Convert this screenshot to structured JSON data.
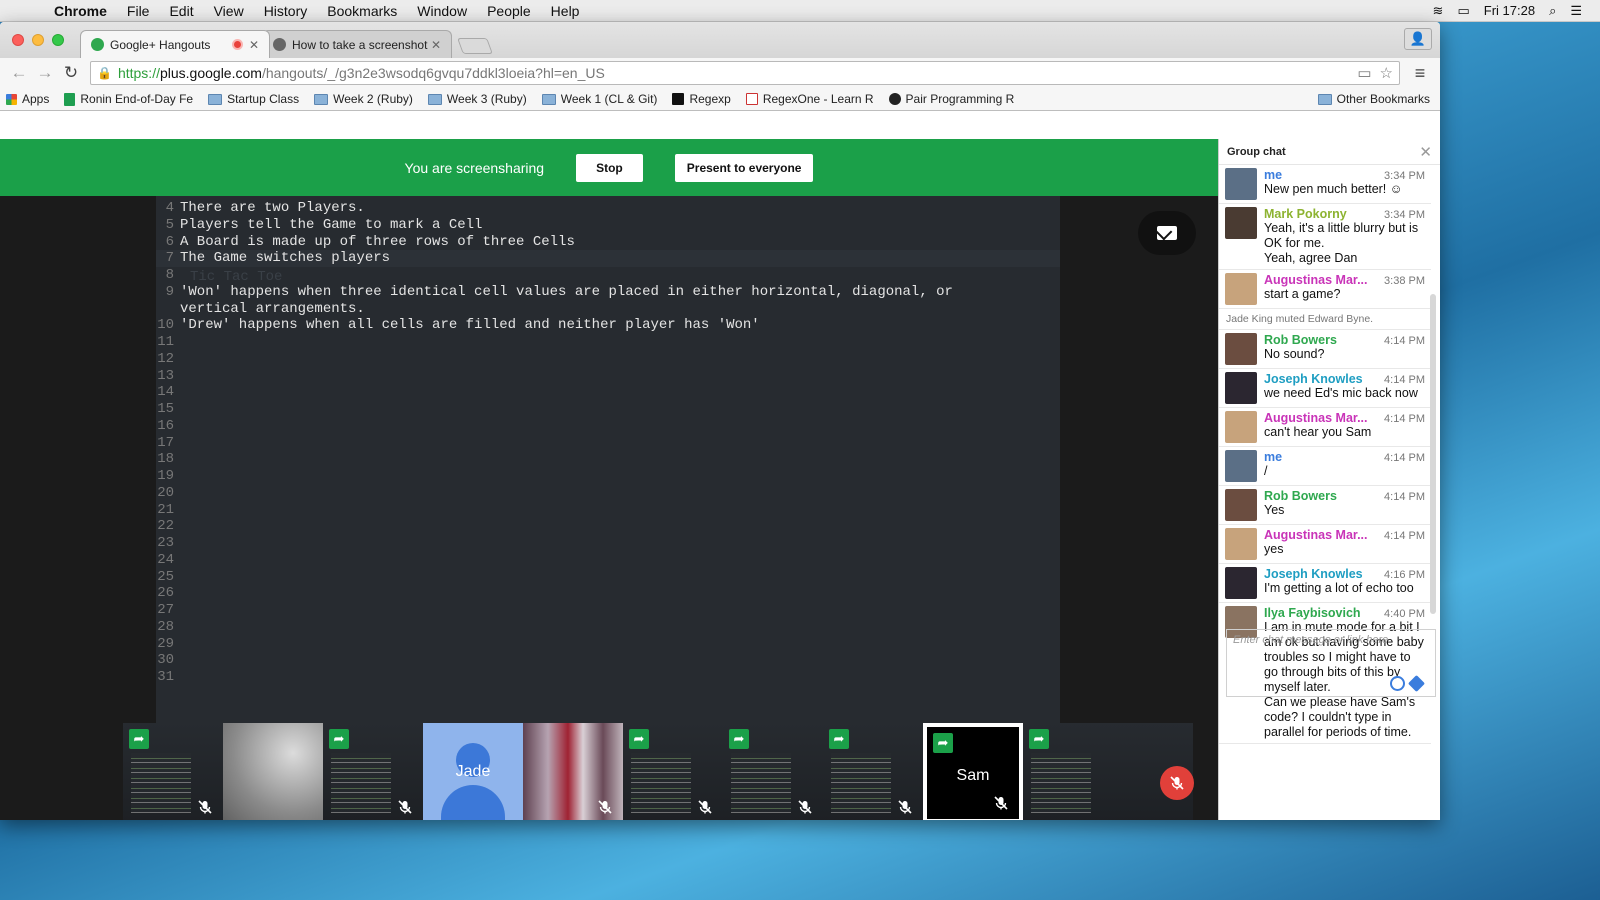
{
  "menubar": {
    "app": "Chrome",
    "items": [
      "File",
      "Edit",
      "View",
      "History",
      "Bookmarks",
      "Window",
      "People",
      "Help"
    ],
    "clock": "Fri 17:28"
  },
  "tabs": [
    {
      "label": "Google+ Hangouts"
    },
    {
      "label": "How to take a screenshot"
    }
  ],
  "omnibox": {
    "scheme": "https://",
    "domain": "plus.google.com",
    "path": "/hangouts/_/g3n2e3wsodq6gvqu7ddkl3loeia?hl=en_US"
  },
  "bookmarks": [
    {
      "label": "Apps",
      "icon": "apps-grid-icon"
    },
    {
      "label": "Ronin End-of-Day Fe",
      "icon": "sheets-icon"
    },
    {
      "label": "Startup Class",
      "icon": "folder-icon"
    },
    {
      "label": "Week 2 (Ruby)",
      "icon": "folder-icon"
    },
    {
      "label": "Week 3 (Ruby)",
      "icon": "folder-icon"
    },
    {
      "label": "Week 1 (CL & Git)",
      "icon": "folder-icon"
    },
    {
      "label": "Regexp",
      "icon": "regexp-icon"
    },
    {
      "label": "RegexOne - Learn R",
      "icon": "regexone-icon"
    },
    {
      "label": "Pair Programming R",
      "icon": "github-icon"
    }
  ],
  "other_bookmarks": "Other Bookmarks",
  "share_banner": {
    "message": "You are screensharing",
    "stop": "Stop",
    "present": "Present to everyone"
  },
  "editor": {
    "ghost_title": "Tic Tac Toe",
    "lines": [
      {
        "n": "4",
        "text": "There are two Players."
      },
      {
        "n": "5",
        "text": "Players tell the Game to mark a Cell"
      },
      {
        "n": "6",
        "text": "A Board is made up of three rows of three Cells"
      },
      {
        "n": "7",
        "text": "The Game switches players"
      },
      {
        "n": "8",
        "text": ""
      },
      {
        "n": "9",
        "text": "'Won' happens when three identical cell values are placed in either horizontal, diagonal, or"
      },
      {
        "n": "",
        "text": "vertical arrangements."
      },
      {
        "n": "10",
        "text": "'Drew' happens when all cells are filled and neither player has 'Won'"
      },
      {
        "n": "11",
        "text": ""
      },
      {
        "n": "12",
        "text": ""
      },
      {
        "n": "13",
        "text": ""
      },
      {
        "n": "14",
        "text": ""
      },
      {
        "n": "15",
        "text": ""
      },
      {
        "n": "16",
        "text": ""
      },
      {
        "n": "17",
        "text": ""
      },
      {
        "n": "18",
        "text": ""
      },
      {
        "n": "19",
        "text": ""
      },
      {
        "n": "20",
        "text": ""
      },
      {
        "n": "21",
        "text": ""
      },
      {
        "n": "22",
        "text": ""
      },
      {
        "n": "23",
        "text": ""
      },
      {
        "n": "24",
        "text": ""
      },
      {
        "n": "25",
        "text": ""
      },
      {
        "n": "26",
        "text": ""
      },
      {
        "n": "27",
        "text": ""
      },
      {
        "n": "28",
        "text": ""
      },
      {
        "n": "29",
        "text": ""
      },
      {
        "n": "30",
        "text": ""
      },
      {
        "n": "31",
        "text": ""
      }
    ]
  },
  "participants": [
    {
      "type": "screen",
      "name": "",
      "sharing": true,
      "muted": true
    },
    {
      "type": "camera-whiteboard",
      "name": "",
      "sharing": false,
      "muted": false
    },
    {
      "type": "screen",
      "name": "",
      "sharing": true,
      "muted": true
    },
    {
      "type": "avatar",
      "name": "Jade",
      "sharing": false,
      "muted": false
    },
    {
      "type": "camera-crowd",
      "name": "",
      "sharing": false,
      "muted": true
    },
    {
      "type": "screen",
      "name": "",
      "sharing": true,
      "muted": true
    },
    {
      "type": "screen",
      "name": "",
      "sharing": true,
      "muted": true
    },
    {
      "type": "screen",
      "name": "",
      "sharing": true,
      "muted": true
    },
    {
      "type": "black",
      "name": "Sam",
      "sharing": true,
      "muted": true
    },
    {
      "type": "screen-wide",
      "name": "",
      "sharing": true,
      "muted": false
    }
  ],
  "chat": {
    "title": "Group chat",
    "input_placeholder": "Enter chat message or link here",
    "messages": [
      {
        "who": "me",
        "color": "#3b7ddd",
        "time": "3:34 PM",
        "text": "New pen much better! ☺",
        "avatar": "#5b6f86"
      },
      {
        "who": "Mark Pokorny",
        "color": "#8db331",
        "time": "3:34 PM",
        "text": "Yeah, it's a little blurry but is OK for me.\nYeah, agree Dan",
        "avatar": "#4a3b32"
      },
      {
        "who": "Augustinas Mar...",
        "color": "#c934b8",
        "time": "3:38 PM",
        "text": "start a game?",
        "avatar": "#c7a37c"
      },
      {
        "system": "Jade King muted Edward Byne."
      },
      {
        "who": "Rob Bowers",
        "color": "#2fa84f",
        "time": "4:14 PM",
        "text": "No sound?",
        "avatar": "#6b4d40"
      },
      {
        "who": "Joseph Knowles",
        "color": "#1f9ec2",
        "time": "4:14 PM",
        "text": "we need Ed's mic back now",
        "avatar": "#2b2630"
      },
      {
        "who": "Augustinas Mar...",
        "color": "#c934b8",
        "time": "4:14 PM",
        "text": "can't hear you Sam",
        "avatar": "#c7a37c"
      },
      {
        "who": "me",
        "color": "#3b7ddd",
        "time": "4:14 PM",
        "text": "/",
        "avatar": "#5b6f86"
      },
      {
        "who": "Rob Bowers",
        "color": "#2fa84f",
        "time": "4:14 PM",
        "text": "Yes",
        "avatar": "#6b4d40"
      },
      {
        "who": "Augustinas Mar...",
        "color": "#c934b8",
        "time": "4:14 PM",
        "text": "yes",
        "avatar": "#c7a37c"
      },
      {
        "who": "Joseph Knowles",
        "color": "#1f9ec2",
        "time": "4:16 PM",
        "text": "I'm getting a lot of echo too",
        "avatar": "#2b2630"
      },
      {
        "who": "Ilya Faybisovich",
        "color": "#2fa84f",
        "time": "4:40 PM",
        "text": "I am in mute mode for a bit I am ok but having some baby troubles so I might have to go through bits of this by myself later.\nCan we please have Sam's code? I couldn't type in parallel for periods of time.",
        "avatar": "#8a7361"
      }
    ]
  }
}
